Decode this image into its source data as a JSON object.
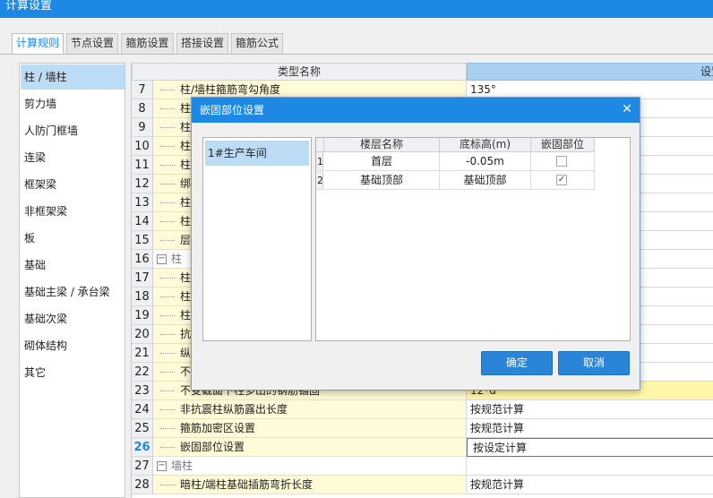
{
  "window": {
    "title": "计算设置"
  },
  "tabs": [
    {
      "label": "计算规则"
    },
    {
      "label": "节点设置"
    },
    {
      "label": "箍筋设置"
    },
    {
      "label": "搭接设置"
    },
    {
      "label": "箍筋公式"
    }
  ],
  "left_list": [
    {
      "label": "柱 / 墙柱"
    },
    {
      "label": "剪力墙"
    },
    {
      "label": "人防门框墙"
    },
    {
      "label": "连梁"
    },
    {
      "label": "框架梁"
    },
    {
      "label": "非框架梁"
    },
    {
      "label": "板"
    },
    {
      "label": "基础"
    },
    {
      "label": "基础主梁 / 承台梁"
    },
    {
      "label": "基础次梁"
    },
    {
      "label": "砌体结构"
    },
    {
      "label": "其它"
    }
  ],
  "grid": {
    "header_name": "类型名称",
    "header_value": "设置",
    "rows": [
      {
        "num": "7",
        "name": "柱/墙柱箍筋弯勾角度",
        "value": "135°"
      },
      {
        "num": "8",
        "name": "柱",
        "value": ""
      },
      {
        "num": "9",
        "name": "柱",
        "value": ""
      },
      {
        "num": "10",
        "name": "柱",
        "value": ""
      },
      {
        "num": "11",
        "name": "柱",
        "value": ""
      },
      {
        "num": "12",
        "name": "绑",
        "value": ""
      },
      {
        "num": "13",
        "name": "柱",
        "value": ""
      },
      {
        "num": "14",
        "name": "柱",
        "value": ""
      },
      {
        "num": "15",
        "name": "层",
        "value": ""
      },
      {
        "num": "16",
        "name": "柱",
        "value": "",
        "group": true
      },
      {
        "num": "17",
        "name": "柱",
        "value": ""
      },
      {
        "num": "18",
        "name": "柱",
        "value": ""
      },
      {
        "num": "19",
        "name": "柱",
        "value": ""
      },
      {
        "num": "20",
        "name": "抗",
        "value": ""
      },
      {
        "num": "21",
        "name": "纵",
        "value": ""
      },
      {
        "num": "22",
        "name": "不",
        "value": ""
      },
      {
        "num": "23",
        "name": "不变截面下柱多出的钢筋锚固",
        "value": "12*d",
        "yellow": true
      },
      {
        "num": "24",
        "name": "非抗震柱纵筋露出长度",
        "value": "按规范计算"
      },
      {
        "num": "25",
        "name": "箍筋加密区设置",
        "value": "按规范计算"
      },
      {
        "num": "26",
        "name": "嵌固部位设置",
        "value": "按设定计算",
        "selected": true
      },
      {
        "num": "27",
        "name": "墙柱",
        "value": "",
        "group": true
      },
      {
        "num": "28",
        "name": "暗柱/端柱基础插筋弯折长度",
        "value": "按规范计算"
      }
    ]
  },
  "dialog": {
    "title": "嵌固部位设置",
    "left_item": "1#生产车间",
    "columns": [
      "楼层名称",
      "底标高(m)",
      "嵌固部位"
    ],
    "rows": [
      {
        "num": "1",
        "floor": "首层",
        "elevation": "-0.05m",
        "checked": false
      },
      {
        "num": "2",
        "floor": "基础顶部",
        "elevation": "基础顶部",
        "checked": true
      }
    ],
    "ok_label": "确定",
    "cancel_label": "取消",
    "close_glyph": "✕",
    "check_glyph": "✓"
  }
}
